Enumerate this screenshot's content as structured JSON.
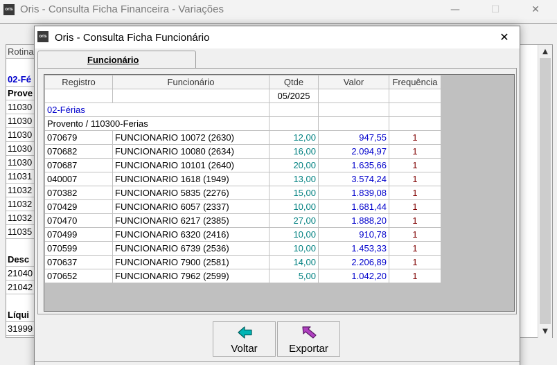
{
  "background": {
    "app_logo": "oris",
    "title": "Oris - Consulta Ficha Financeira - Variações",
    "rows": [
      {
        "text": "Rotina",
        "style": "hdr"
      },
      {
        "text": "",
        "style": "empty"
      },
      {
        "text": "02-Fé",
        "style": "blue"
      },
      {
        "text": "Prove",
        "style": "bold"
      },
      {
        "text": "11030",
        "style": ""
      },
      {
        "text": "11030",
        "style": ""
      },
      {
        "text": "11030",
        "style": ""
      },
      {
        "text": "11030",
        "style": ""
      },
      {
        "text": "11030",
        "style": ""
      },
      {
        "text": "11031",
        "style": ""
      },
      {
        "text": "11032",
        "style": ""
      },
      {
        "text": "11032",
        "style": ""
      },
      {
        "text": "11032",
        "style": ""
      },
      {
        "text": "11035",
        "style": ""
      },
      {
        "text": "",
        "style": "empty"
      },
      {
        "text": "Desc",
        "style": "bold"
      },
      {
        "text": "21040",
        "style": ""
      },
      {
        "text": "21042",
        "style": ""
      },
      {
        "text": "",
        "style": "empty"
      },
      {
        "text": "Líqui",
        "style": "bold"
      },
      {
        "text": "31999",
        "style": ""
      }
    ]
  },
  "dialog": {
    "app_logo": "oris",
    "title": "Oris - Consulta Ficha Funcionário",
    "close_icon": "close-icon",
    "tab_label": "Funcionário",
    "grid": {
      "columns": [
        "Registro",
        "Funcionário",
        "Qtde",
        "Valor",
        "Frequência"
      ],
      "period": "05/2025",
      "group": "02-Férias",
      "subgroup": "Provento / 110300-Ferias",
      "rows": [
        {
          "registro": "070679",
          "funcionario": "FUNCIONARIO 10072 (2630)",
          "qtde": "12,00",
          "valor": "947,55",
          "freq": "1"
        },
        {
          "registro": "070682",
          "funcionario": "FUNCIONARIO 10080 (2634)",
          "qtde": "16,00",
          "valor": "2.094,97",
          "freq": "1"
        },
        {
          "registro": "070687",
          "funcionario": "FUNCIONARIO 10101 (2640)",
          "qtde": "20,00",
          "valor": "1.635,66",
          "freq": "1"
        },
        {
          "registro": "040007",
          "funcionario": "FUNCIONARIO 1618 (1949)",
          "qtde": "13,00",
          "valor": "3.574,24",
          "freq": "1"
        },
        {
          "registro": "070382",
          "funcionario": "FUNCIONARIO 5835 (2276)",
          "qtde": "15,00",
          "valor": "1.839,08",
          "freq": "1"
        },
        {
          "registro": "070429",
          "funcionario": "FUNCIONARIO 6057 (2337)",
          "qtde": "10,00",
          "valor": "1.681,44",
          "freq": "1"
        },
        {
          "registro": "070470",
          "funcionario": "FUNCIONARIO 6217 (2385)",
          "qtde": "27,00",
          "valor": "1.888,20",
          "freq": "1"
        },
        {
          "registro": "070499",
          "funcionario": "FUNCIONARIO 6320 (2416)",
          "qtde": "10,00",
          "valor": "910,78",
          "freq": "1"
        },
        {
          "registro": "070599",
          "funcionario": "FUNCIONARIO 6739 (2536)",
          "qtde": "10,00",
          "valor": "1.453,33",
          "freq": "1"
        },
        {
          "registro": "070637",
          "funcionario": "FUNCIONARIO 7900 (2581)",
          "qtde": "14,00",
          "valor": "2.206,89",
          "freq": "1"
        },
        {
          "registro": "070652",
          "funcionario": "FUNCIONARIO 7962 (2599)",
          "qtde": "5,00",
          "valor": "1.042,20",
          "freq": "1"
        }
      ]
    },
    "buttons": {
      "voltar": {
        "label": "Voltar",
        "icon": "arrow-left-icon"
      },
      "exportar": {
        "label": "Exportar",
        "icon": "arrow-export-icon"
      }
    }
  },
  "colors": {
    "qtde": "#008080",
    "valor": "#0000cc",
    "freq": "#800000",
    "voltar_icon": "#00a8a8",
    "exportar_icon": "#b040c0"
  }
}
